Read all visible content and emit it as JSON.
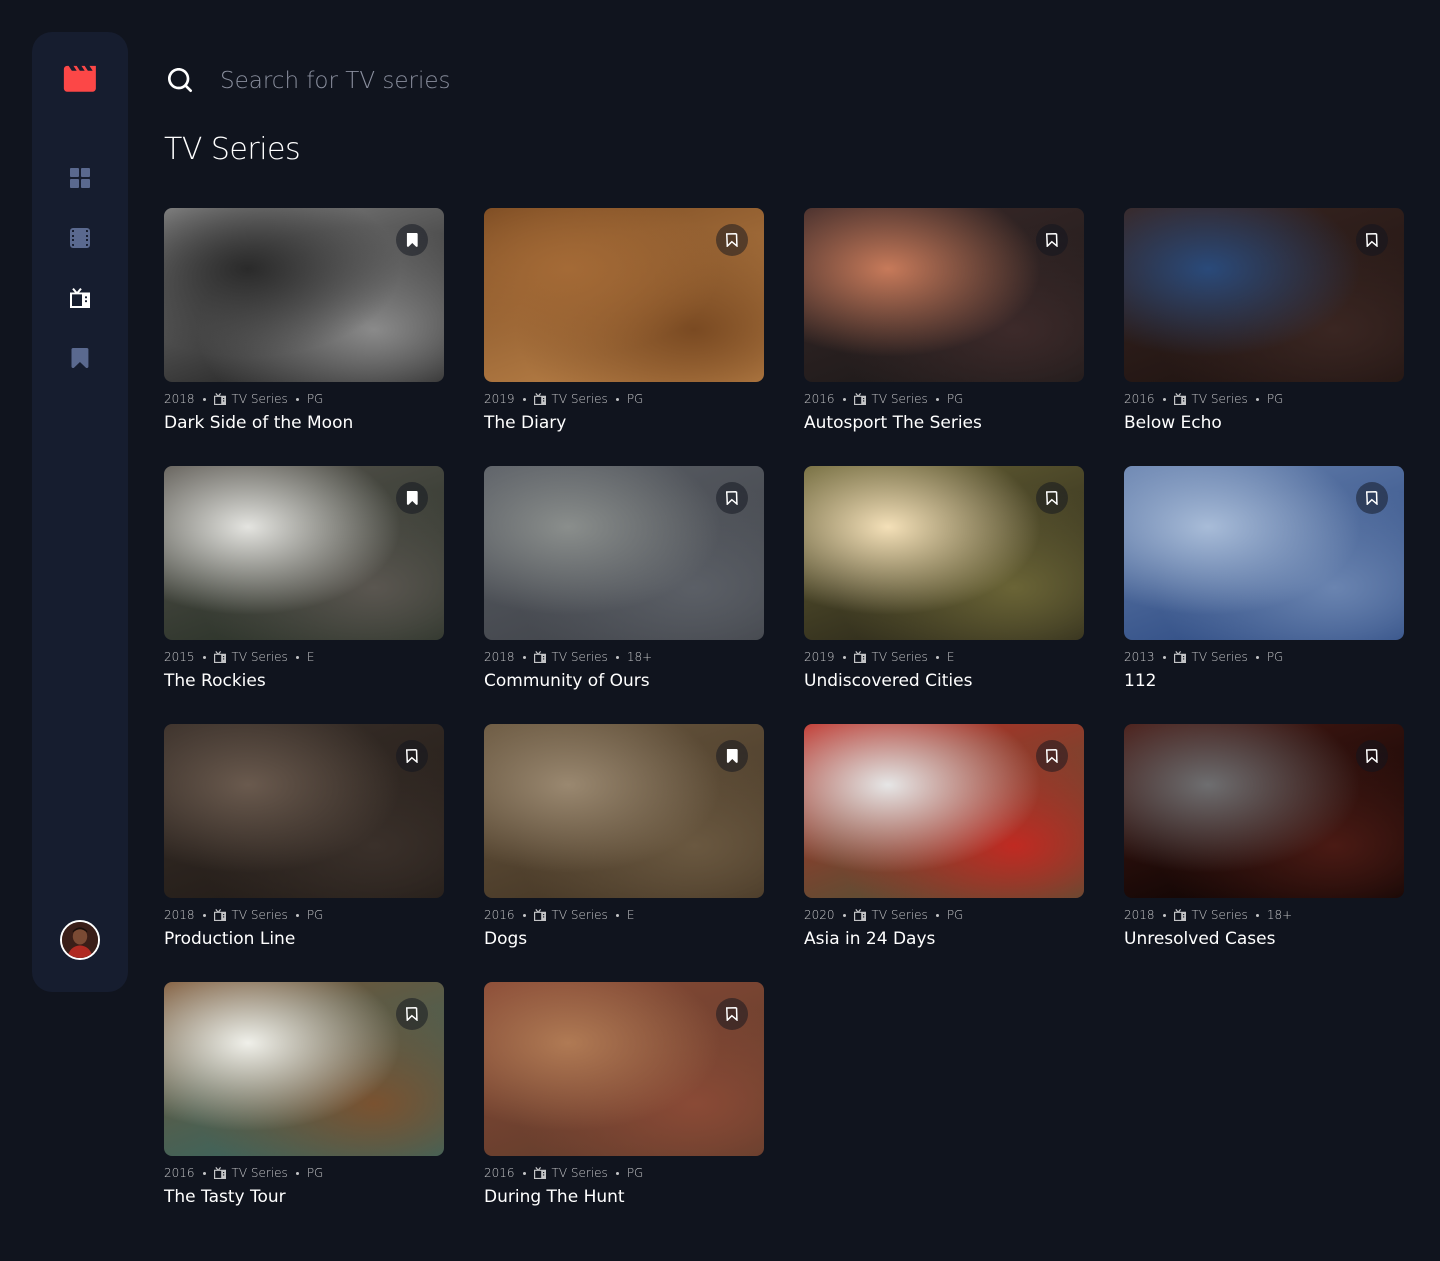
{
  "search": {
    "placeholder": "Search for TV series",
    "value": ""
  },
  "page": {
    "title": "TV Series"
  },
  "colors": {
    "background": "#10141E",
    "sidebar": "#161D2F",
    "accent": "#FC4747",
    "nav_inactive": "#5A698F",
    "nav_active": "#FFFFFF"
  },
  "sidebar": {
    "logo": "clapperboard-logo-icon",
    "items": [
      {
        "icon": "grid-icon",
        "active": false
      },
      {
        "icon": "film-icon",
        "active": false
      },
      {
        "icon": "tv-icon",
        "active": true
      },
      {
        "icon": "bookmark-icon",
        "active": false
      }
    ],
    "avatar": "user-avatar"
  },
  "shows": [
    {
      "year": "2018",
      "category": "TV Series",
      "rating": "PG",
      "title": "Dark Side of the Moon",
      "bookmarked": true,
      "image": "moon",
      "colors": [
        "#2a2a2a",
        "#8a8a8a",
        "#0d0d0d"
      ]
    },
    {
      "year": "2019",
      "category": "TV Series",
      "rating": "PG",
      "title": "The Diary",
      "bookmarked": false,
      "image": "wooden desk with notepad",
      "colors": [
        "#a46a36",
        "#7a4a22",
        "#c48a4e"
      ]
    },
    {
      "year": "2016",
      "category": "TV Series",
      "rating": "PG",
      "title": "Autosport The Series",
      "bookmarked": false,
      "image": "white car at dusk",
      "colors": [
        "#c77a5a",
        "#3d2a2a",
        "#161616"
      ]
    },
    {
      "year": "2016",
      "category": "TV Series",
      "rating": "PG",
      "title": "Below Echo",
      "bookmarked": false,
      "image": "canyon night sky",
      "colors": [
        "#2a4a7a",
        "#3a2622",
        "#1a100e"
      ]
    },
    {
      "year": "2015",
      "category": "TV Series",
      "rating": "E",
      "title": "The Rockies",
      "bookmarked": true,
      "image": "waterfall mountains",
      "colors": [
        "#e4e4e0",
        "#5a5650",
        "#1f2a1f"
      ]
    },
    {
      "year": "2018",
      "category": "TV Series",
      "rating": "18+",
      "title": "Community of Ours",
      "bookmarked": false,
      "image": "people playing cards",
      "colors": [
        "#8a8e8c",
        "#5b5f66",
        "#3c3f45"
      ]
    },
    {
      "year": "2019",
      "category": "TV Series",
      "rating": "E",
      "title": "Undiscovered Cities",
      "bookmarked": false,
      "image": "steering wheel",
      "colors": [
        "#f4e0b8",
        "#6a6436",
        "#1e1c14"
      ]
    },
    {
      "year": "2013",
      "category": "TV Series",
      "rating": "PG",
      "title": "112",
      "bookmarked": false,
      "image": "blood pressure cuff",
      "colors": [
        "#a8bcd8",
        "#6a84b0",
        "#22407a"
      ]
    },
    {
      "year": "2018",
      "category": "TV Series",
      "rating": "PG",
      "title": "Production Line",
      "bookmarked": false,
      "image": "glass blowing",
      "colors": [
        "#6a5a4e",
        "#3a302a",
        "#1e1814"
      ]
    },
    {
      "year": "2016",
      "category": "TV Series",
      "rating": "E",
      "title": "Dogs",
      "bookmarked": true,
      "image": "setter dog",
      "colors": [
        "#9a8870",
        "#6a5840",
        "#3e3020"
      ]
    },
    {
      "year": "2020",
      "category": "TV Series",
      "rating": "PG",
      "title": "Asia in 24 Days",
      "bookmarked": false,
      "image": "chinese gate",
      "colors": [
        "#e6e6e6",
        "#c02a22",
        "#3a5a3a"
      ]
    },
    {
      "year": "2018",
      "category": "TV Series",
      "rating": "18+",
      "title": "Unresolved Cases",
      "bookmarked": false,
      "image": "window view city",
      "colors": [
        "#6e6e70",
        "#4a1a14",
        "#000000"
      ]
    },
    {
      "year": "2016",
      "category": "TV Series",
      "rating": "PG",
      "title": "The Tasty Tour",
      "bookmarked": false,
      "image": "food bowl",
      "colors": [
        "#f0f0ea",
        "#7a5230",
        "#2a6a6a"
      ]
    },
    {
      "year": "2016",
      "category": "TV Series",
      "rating": "PG",
      "title": "During The Hunt",
      "bookmarked": false,
      "image": "deer",
      "colors": [
        "#b07a54",
        "#8a4a36",
        "#5a3a2a"
      ]
    }
  ]
}
